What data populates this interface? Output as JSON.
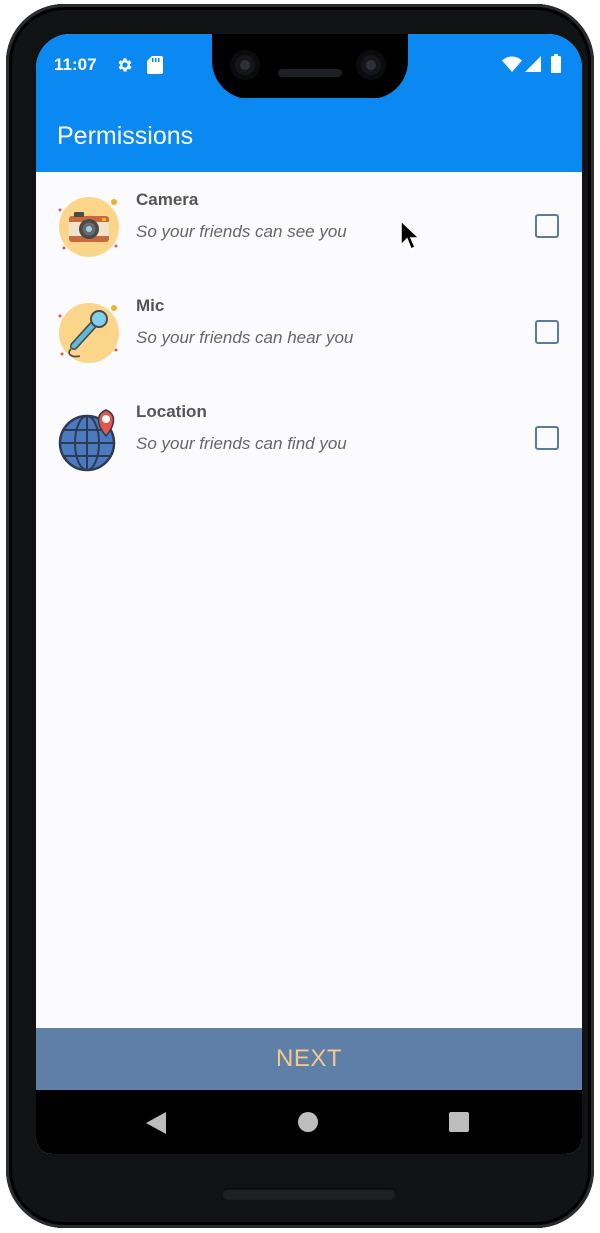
{
  "status_bar": {
    "time": "11:07",
    "left_icons": [
      "gear-icon",
      "sd-card-icon"
    ],
    "right_icons": [
      "wifi-icon",
      "signal-icon",
      "battery-icon"
    ]
  },
  "app_bar": {
    "title": "Permissions"
  },
  "permissions": [
    {
      "title": "Camera",
      "subtitle": "So your friends can see you",
      "icon": "camera-icon",
      "checked": false
    },
    {
      "title": "Mic",
      "subtitle": "So your friends can hear you",
      "icon": "microphone-icon",
      "checked": false
    },
    {
      "title": "Location",
      "subtitle": "So your friends can find you",
      "icon": "globe-location-icon",
      "checked": false
    }
  ],
  "next_button": {
    "label": "NEXT"
  },
  "colors": {
    "primary": "#0a89f2",
    "button_background": "#5e7fa8",
    "button_text": "#f4c98a",
    "checkbox_border": "#5a7aa0"
  },
  "nav_bar": {
    "icons": [
      "back-icon",
      "home-icon",
      "recents-icon"
    ]
  }
}
